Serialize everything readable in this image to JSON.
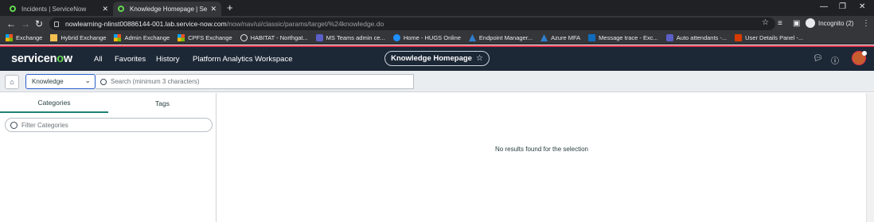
{
  "browser": {
    "tabs": [
      {
        "title": "Incidents | ServiceNow",
        "active": false
      },
      {
        "title": "Knowledge Homepage | ServiceN",
        "active": true
      }
    ],
    "url_host": "nowlearning-nlinst00886144-001.lab.service-now.com",
    "url_path": "/now/nav/ui/classic/params/target/%24knowledge.do",
    "profile_label": "Incognito (2)",
    "bookmarks": [
      {
        "label": "Exchange",
        "icon": "microsoft-icon"
      },
      {
        "label": "Hybrid Exchange",
        "icon": "bookmark-folder-icon"
      },
      {
        "label": "Admin Exchange",
        "icon": "microsoft-icon"
      },
      {
        "label": "CPFS Exchange",
        "icon": "microsoft-icon"
      },
      {
        "label": "HABITAT - Northgat...",
        "icon": "globe-icon"
      },
      {
        "label": "MS Teams admin ce...",
        "icon": "teams-icon"
      },
      {
        "label": "Home - HUGS Online",
        "icon": "hugs-icon"
      },
      {
        "label": "Endpoint Manager...",
        "icon": "azure-icon"
      },
      {
        "label": "Azure MFA",
        "icon": "azure-icon"
      },
      {
        "label": "Message trace - Exc...",
        "icon": "outlook-icon"
      },
      {
        "label": "Auto attendants -...",
        "icon": "teams-icon"
      },
      {
        "label": "User Details Panel -...",
        "icon": "office-icon"
      }
    ]
  },
  "sn_header": {
    "logo_text_pre": "servicen",
    "logo_text_o": "o",
    "logo_text_post": "w",
    "nav": [
      "All",
      "Favorites",
      "History",
      "Platform Analytics Workspace"
    ],
    "page_pill": "Knowledge Homepage"
  },
  "search_bar": {
    "scope_value": "Knowledge",
    "placeholder": "Search (minimum 3 characters)"
  },
  "left_panel": {
    "tabs": [
      "Categories",
      "Tags"
    ],
    "filter_placeholder": "Filter Categories"
  },
  "main": {
    "empty_message": "No results found for the selection"
  },
  "colors": {
    "sn_header_bg": "#1d2837",
    "accent_green": "#62d84e",
    "active_tab_underline": "#1f8476"
  }
}
